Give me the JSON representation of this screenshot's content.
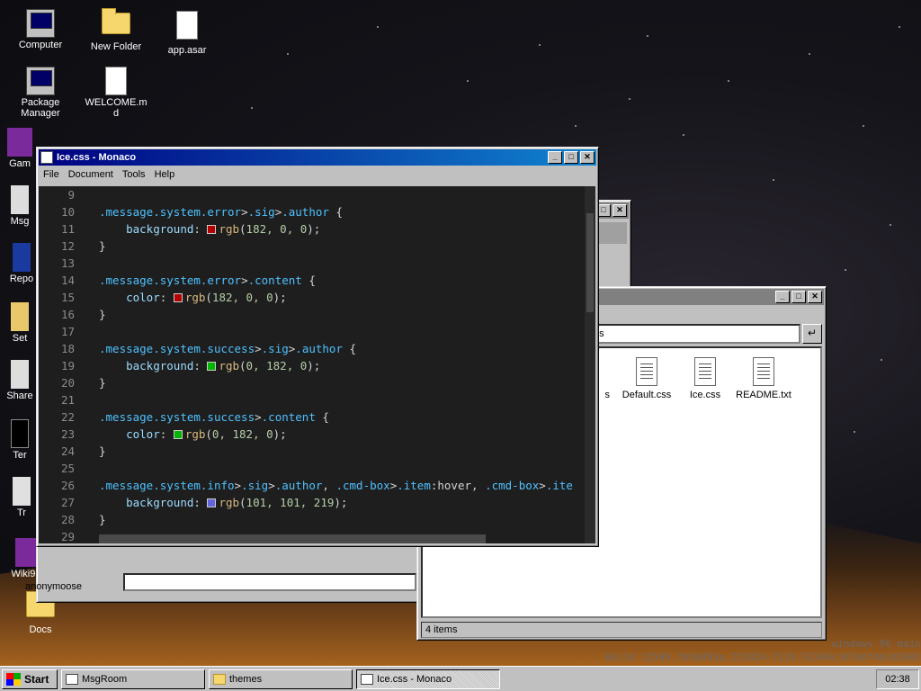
{
  "desktop": {
    "icons": [
      {
        "label": "Computer"
      },
      {
        "label": "New Folder"
      },
      {
        "label": "app.asar"
      },
      {
        "label": "Package Manager"
      },
      {
        "label": "WELCOME.md"
      },
      {
        "label": "Gam"
      },
      {
        "label": "Msg"
      },
      {
        "label": "Repo"
      },
      {
        "label": "Set"
      },
      {
        "label": "Share"
      },
      {
        "label": "Ter"
      },
      {
        "label": "Tr"
      },
      {
        "label": "Wiki96"
      },
      {
        "label": "Docs"
      }
    ],
    "build_text": [
      "windows 96 main",
      "Build 11589.7b9a893a.211024-1119.52346c3d7ebf4b3d2683"
    ]
  },
  "editor_window": {
    "title": "Ice.css - Monaco",
    "menu": [
      "File",
      "Document",
      "Tools",
      "Help"
    ],
    "lines": [
      {
        "n": "9",
        "text": ""
      },
      {
        "n": "10",
        "text": ".message.system.error>.sig>.author {"
      },
      {
        "n": "11",
        "text": "    background: rgb(182, 0, 0);",
        "swatch": "#b60000"
      },
      {
        "n": "12",
        "text": "}"
      },
      {
        "n": "13",
        "text": ""
      },
      {
        "n": "14",
        "text": ".message.system.error>.content {"
      },
      {
        "n": "15",
        "text": "    color: rgb(182, 0, 0);",
        "swatch": "#b60000"
      },
      {
        "n": "16",
        "text": "}"
      },
      {
        "n": "17",
        "text": ""
      },
      {
        "n": "18",
        "text": ".message.system.success>.sig>.author {"
      },
      {
        "n": "19",
        "text": "    background: rgb(0, 182, 0);",
        "swatch": "#00b600"
      },
      {
        "n": "20",
        "text": "}"
      },
      {
        "n": "21",
        "text": ""
      },
      {
        "n": "22",
        "text": ".message.system.success>.content {"
      },
      {
        "n": "23",
        "text": "    color: rgb(0, 182, 0);",
        "swatch": "#00b600"
      },
      {
        "n": "24",
        "text": "}"
      },
      {
        "n": "25",
        "text": ""
      },
      {
        "n": "26",
        "text": ".message.system.info>.sig>.author, .cmd-box>.item:hover, .cmd-box>.ite"
      },
      {
        "n": "27",
        "text": "    background: rgb(101, 101, 219);",
        "swatch": "#6565db"
      },
      {
        "n": "28",
        "text": "}"
      },
      {
        "n": "29",
        "text": ""
      }
    ]
  },
  "explorer_window": {
    "address": "es",
    "files": [
      {
        "label": "s"
      },
      {
        "label": "Default.css"
      },
      {
        "label": "Ice.css"
      },
      {
        "label": "README.txt"
      }
    ],
    "status": "4 items"
  },
  "msgroom_window": {
    "nickname": "anonymoose"
  },
  "taskbar": {
    "start_label": "Start",
    "tasks": [
      {
        "label": "MsgRoom"
      },
      {
        "label": "themes"
      },
      {
        "label": "Ice.css - Monaco"
      }
    ],
    "clock": "02:38"
  }
}
